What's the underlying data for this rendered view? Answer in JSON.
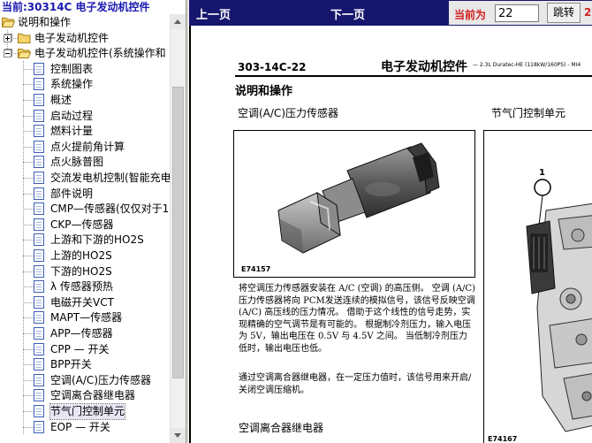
{
  "sidebar": {
    "current_title": "当前:30314C 电子发动机控件",
    "tree": [
      {
        "label": "说明和操作",
        "level": 0,
        "type": "folder",
        "expander": "minus"
      },
      {
        "label": "电子发动机控件",
        "level": 1,
        "type": "folder",
        "expander": "plus"
      },
      {
        "label": "电子发动机控件(系统操作和",
        "level": 1,
        "type": "folder",
        "expander": "minus"
      },
      {
        "label": "控制图表",
        "level": 2,
        "type": "doc"
      },
      {
        "label": "系统操作",
        "level": 2,
        "type": "doc"
      },
      {
        "label": "概述",
        "level": 2,
        "type": "doc"
      },
      {
        "label": "启动过程",
        "level": 2,
        "type": "doc"
      },
      {
        "label": "燃料计量",
        "level": 2,
        "type": "doc"
      },
      {
        "label": "点火提前角计算",
        "level": 2,
        "type": "doc"
      },
      {
        "label": "点火脉普图",
        "level": 2,
        "type": "doc"
      },
      {
        "label": "交流发电机控制(智能充电",
        "level": 2,
        "type": "doc"
      },
      {
        "label": "部件说明",
        "level": 2,
        "type": "doc"
      },
      {
        "label": "CMP—传感器(仅仅对于1",
        "level": 2,
        "type": "doc"
      },
      {
        "label": "CKP—传感器",
        "level": 2,
        "type": "doc"
      },
      {
        "label": "上游和下游的HO2S",
        "level": 2,
        "type": "doc"
      },
      {
        "label": "上游的HO2S",
        "level": 2,
        "type": "doc"
      },
      {
        "label": "下游的HO2S",
        "level": 2,
        "type": "doc"
      },
      {
        "label": "λ 传感器预热",
        "level": 2,
        "type": "doc"
      },
      {
        "label": "电磁开关VCT",
        "level": 2,
        "type": "doc"
      },
      {
        "label": "MAPT—传感器",
        "level": 2,
        "type": "doc"
      },
      {
        "label": "APP—传感器",
        "level": 2,
        "type": "doc"
      },
      {
        "label": "CPP — 开关",
        "level": 2,
        "type": "doc"
      },
      {
        "label": "BPP开关",
        "level": 2,
        "type": "doc"
      },
      {
        "label": "空调(A/C)压力传感器",
        "level": 2,
        "type": "doc"
      },
      {
        "label": "空调离合器继电器",
        "level": 2,
        "type": "doc"
      },
      {
        "label": "节气门控制单元",
        "level": 2,
        "type": "doc",
        "selected": true
      },
      {
        "label": "EOP — 开关",
        "level": 2,
        "type": "doc"
      }
    ]
  },
  "nav": {
    "prev_label": "上一页",
    "next_label": "下一页",
    "current_label": "当前为",
    "page_value": "22",
    "go_label": "跳转",
    "total_label": "2"
  },
  "document": {
    "code": "303-14C-22",
    "heading": "电子发动机控件",
    "subheading": "— 2.3L Duratec-HE (118kW/160PS) - MI4",
    "section": "说明和操作",
    "part_1_title": "空调(A/C)压力传感器",
    "part_2_title": "节气门控制单元",
    "figure_1_label": "E74157",
    "figure_2_label": "E74167",
    "figure_2_callout": "1",
    "desc_1": "将空调压力传感器安装在 A/C (空调) 的高压侧。 空调 (A/C) 压力传感器将向 PCM发送连续的模拟信号，该信号反映空调 (A/C) 高压线的压力情况。 借助于这个线性的信号走势，实现精确的空气调节是有可能的。 根据制冷剂压力，输入电压为 5V，输出电压在 0.5V 与 4.5V 之间。 当低制冷剂压力低时，输出电压也低。",
    "desc_2": "通过空调离合器继电器，在一定压力值时，该信号用来开启/关闭空调压缩机。",
    "part_3_title": "空调离合器继电器"
  },
  "colors": {
    "nav_background": "#16166e",
    "title_blue": "#1a1ab0",
    "label_red": "#d32020"
  }
}
